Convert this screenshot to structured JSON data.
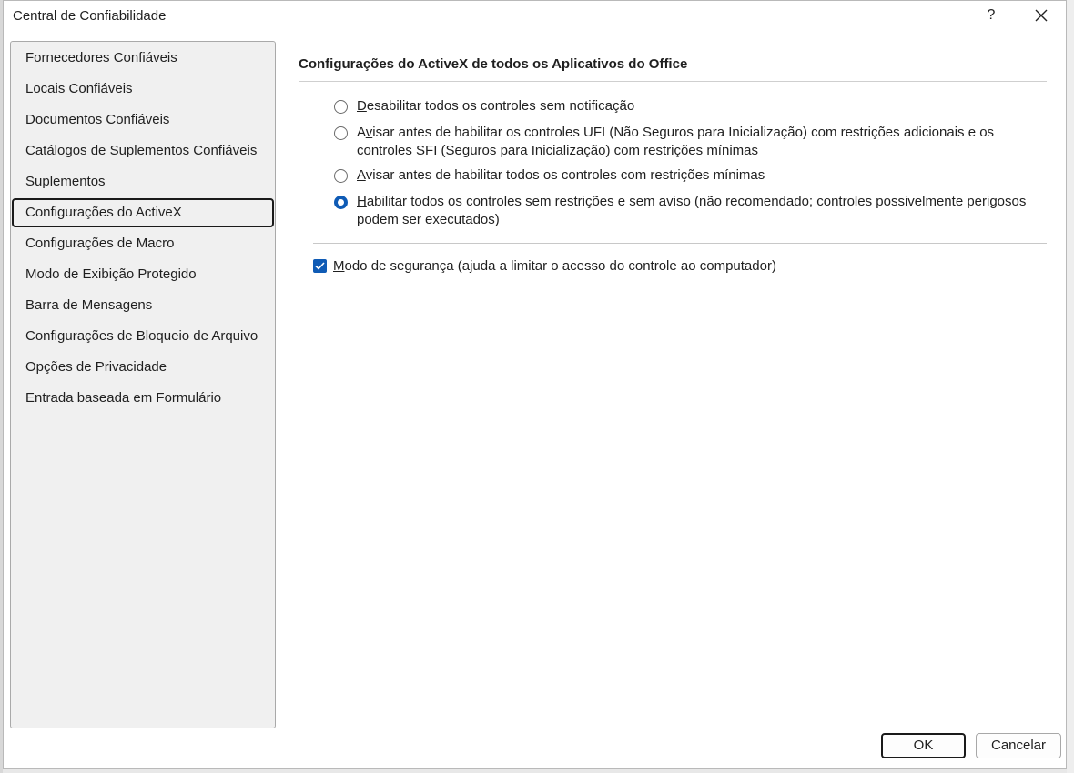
{
  "dialog": {
    "title": "Central de Confiabilidade",
    "help_label": "?",
    "close_icon": "close-icon"
  },
  "sidebar": {
    "items": [
      {
        "label": "Fornecedores Confiáveis"
      },
      {
        "label": "Locais Confiáveis"
      },
      {
        "label": "Documentos Confiáveis"
      },
      {
        "label": "Catálogos de Suplementos Confiáveis"
      },
      {
        "label": "Suplementos"
      },
      {
        "label": "Configurações do ActiveX",
        "selected": true
      },
      {
        "label": "Configurações de Macro"
      },
      {
        "label": "Modo de Exibição Protegido"
      },
      {
        "label": "Barra de Mensagens"
      },
      {
        "label": "Configurações de Bloqueio de Arquivo"
      },
      {
        "label": "Opções de Privacidade"
      },
      {
        "label": "Entrada baseada em Formulário"
      }
    ]
  },
  "main": {
    "section_title": "Configurações do ActiveX de todos os Aplicativos do Office",
    "options": [
      {
        "accel": "D",
        "rest": "esabilitar todos os controles sem notificação",
        "checked": false
      },
      {
        "pre": "A",
        "accel": "v",
        "rest": "isar antes de habilitar os controles UFI (Não Seguros para Inicialização) com restrições adicionais e os controles SFI (Seguros para Inicialização) com restrições mínimas",
        "checked": false
      },
      {
        "accel": "A",
        "rest": "visar antes de habilitar todos os controles com restrições mínimas",
        "checked": false
      },
      {
        "accel": "H",
        "rest": "abilitar todos os controles sem restrições e sem aviso (não recomendado; controles possivelmente perigosos podem ser executados)",
        "checked": true
      }
    ],
    "safe_mode": {
      "accel": "M",
      "rest": "odo de segurança (ajuda a limitar o acesso do controle ao computador)",
      "checked": true
    }
  },
  "footer": {
    "ok_label": "OK",
    "cancel_label": "Cancelar"
  },
  "colors": {
    "accent": "#0f5bb5",
    "sidebar_bg": "#f0f0f0"
  }
}
